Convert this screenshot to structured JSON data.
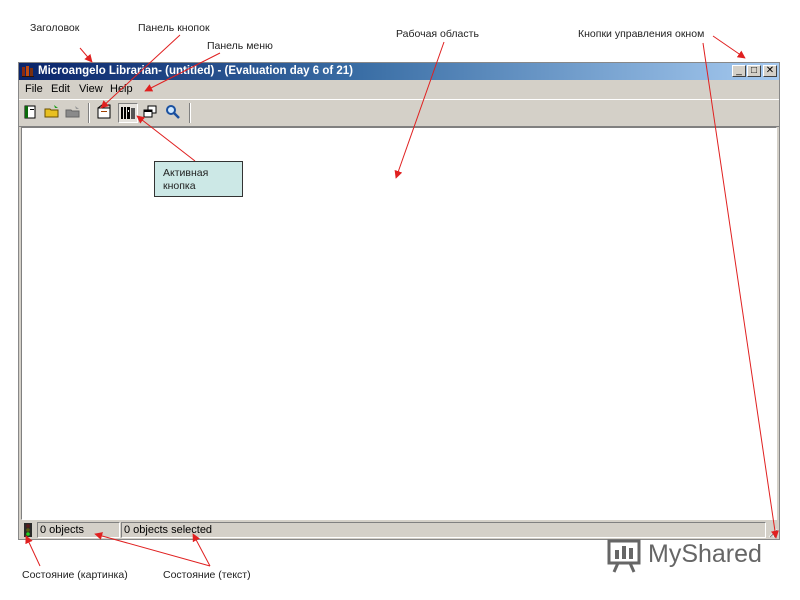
{
  "annotations": {
    "title": "Заголовок",
    "toolbar": "Панель кнопок",
    "menubar": "Панель меню",
    "workarea": "Рабочая область",
    "window_buttons": "Кнопки управления окном",
    "active_button_line1": "Активная",
    "active_button_line2": "кнопка",
    "status_image": "Состояние (картинка)",
    "status_text": "Состояние (текст)"
  },
  "window": {
    "title": "Microangelo Librarian- (untitled) -  (Evaluation day 6 of 21)",
    "buttons": {
      "minimize": "_",
      "maximize": "□",
      "close": "✕"
    }
  },
  "menu": [
    "File",
    "Edit",
    "View",
    "Help"
  ],
  "toolbar_icons": [
    "new-book-icon",
    "open-folder-icon",
    "disabled-folder-icon",
    "open-file-icon",
    "library-view-icon",
    "cascade-windows-icon",
    "search-icon"
  ],
  "status": {
    "objects": "0 objects",
    "selected": "0 objects selected"
  },
  "logo": {
    "text": "MyShared"
  },
  "colors": {
    "titlebar_start": "#0a246a",
    "titlebar_end": "#a6caf0",
    "callout_bg": "#cce8e6",
    "arrow": "#e02020"
  }
}
